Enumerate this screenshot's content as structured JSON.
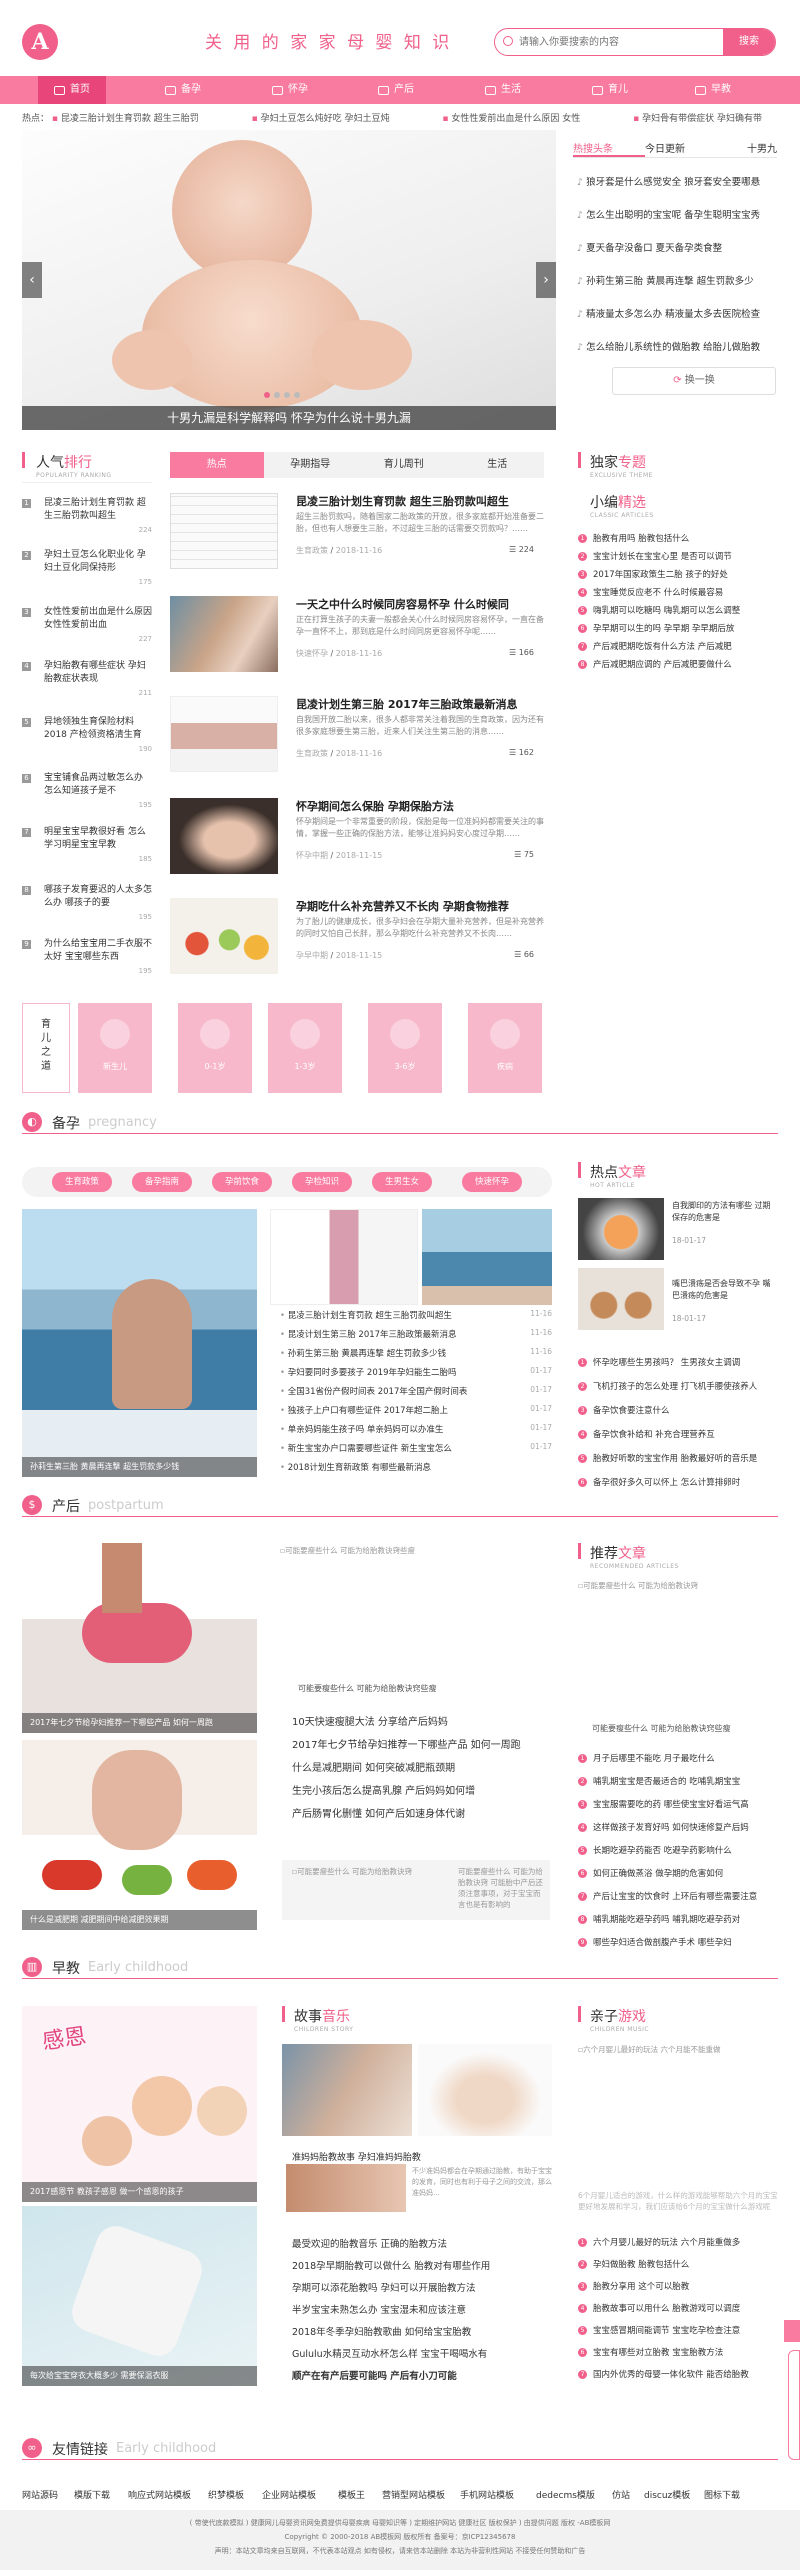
{
  "header": {
    "logo_letter": "A",
    "slogan": "关 用 的 家 家 母 婴 知 识",
    "search_placeholder": "请输入你要搜索的内容",
    "search_button": "搜索"
  },
  "nav": [
    {
      "label": "首页",
      "icon": "home-icon"
    },
    {
      "label": "备孕",
      "icon": "calendar-icon"
    },
    {
      "label": "怀孕",
      "icon": "pregnant-icon"
    },
    {
      "label": "产后",
      "icon": "baby-carriage-icon"
    },
    {
      "label": "生活",
      "icon": "cup-icon"
    },
    {
      "label": "育儿",
      "icon": "bottle-icon"
    },
    {
      "label": "早教",
      "icon": "book-icon"
    }
  ],
  "ticker": {
    "label": "热点：",
    "items": [
      "昆凌三胎计划生育罚款 超生三胎罚",
      "孕妇土豆怎么炖好吃 孕妇土豆炖",
      "女性性爱前出血是什么原因 女性",
      "孕妇骨有带偿症状 孕妇确有带"
    ]
  },
  "banner": {
    "caption": "十男九漏是科学解释吗 怀孕为什么说十男九漏",
    "prev": "‹",
    "next": "›"
  },
  "hot_news": {
    "tabs": [
      "热搜头条",
      "今日更新",
      "十男九"
    ],
    "items": [
      "狼牙套是什么感觉安全 狼牙套安全要哪悬",
      "怎么生出聪明的宝宝呢 备孕生聪明宝宝秀",
      "夏天备孕没备口 夏天备孕类食整",
      "孙莉生第三胎 黄晨再连撃 超生罚款多少",
      "精液量太多怎么办 精液量太多去医院检查",
      "怎么给胎儿系统性的做胎教 给胎儿做胎教"
    ],
    "swap_label": "换一换"
  },
  "popularity": {
    "title_a": "人气",
    "title_b": "排行",
    "en": "POPULARITY RANKING",
    "items": [
      {
        "num": "1",
        "text": "昆凌三胎计划生育罚款 超生三胎罚款叫超生",
        "count": "224"
      },
      {
        "num": "2",
        "text": "孕妇土豆怎么化职业化 孕妇土豆化同保持形",
        "count": "175"
      },
      {
        "num": "3",
        "text": "女性性爱前出血是什么原因 女性性爱前出血",
        "count": "227"
      },
      {
        "num": "4",
        "text": "孕妇胎教有哪些症状 孕妇胎教症状表现",
        "count": "211"
      },
      {
        "num": "5",
        "text": "异地领独生育保险材料 2018 产检领资格清生育",
        "count": "190"
      },
      {
        "num": "6",
        "text": "宝宝铺食品两过敏怎么办 怎么知道孩子是不",
        "count": "195"
      },
      {
        "num": "7",
        "text": "明星宝宝早教很好看 怎么学习明星宝宝早教",
        "count": "185"
      },
      {
        "num": "8",
        "text": "哪孩子发育要迟的人太多怎么办 哪孩子的要",
        "count": "195"
      },
      {
        "num": "9",
        "text": "为什么给宝宝用二手衣服不太好 宝宝哪些东西",
        "count": "195"
      }
    ]
  },
  "center_tabs": [
    "热点",
    "孕期指导",
    "育儿周刊",
    "生活"
  ],
  "articles": [
    {
      "title": "昆凌三胎计划生育罚款 超生三胎罚款叫超生",
      "desc": "超生三胎罚款吗，随着国家二胎政策的开放，很多家庭都开始准备要二胎，但也有人想要生三胎，不过超生三胎的话需要交罚款吗？……",
      "cat": "生育政策",
      "date": "2018-11-16",
      "count": "224"
    },
    {
      "title": "一天之中什么时候同房容易怀孕 什么时候同",
      "desc": "正在打算生孩子的夫妻一般都会关心什么时候同房容易怀孕，一直在备孕一直怀不上，那到底是什么时间同房更容易怀孕呢……",
      "cat": "快速怀孕",
      "date": "2018-11-16",
      "count": "166"
    },
    {
      "title": "昆凌计划生第三胎 2017年三胎政策最新消息",
      "desc": "自我国开放二胎以来，很多人都非常关注着我国的生育政策，因为还有很多家庭想要生第三胎，近来人们关注生第三胎的消息……",
      "cat": "生育政策",
      "date": "2018-11-16",
      "count": "162"
    },
    {
      "title": "怀孕期间怎么保胎 孕期保胎方法",
      "desc": "怀孕期间是一个非常重要的阶段，保胎是每一位准妈妈都需要关注的事情，掌握一些正确的保胎方法，能够让准妈妈安心度过孕期……",
      "cat": "怀孕中期",
      "date": "2018-11-15",
      "count": "75"
    },
    {
      "title": "孕期吃什么补充营养又不长肉 孕期食物推荐",
      "desc": "为了胎儿的健康成长，很多孕妇会在孕期大量补充营养，但是补充营养的同时又怕自己长胖，那么孕期吃什么补充营养又不长肉……",
      "cat": "孕早中期",
      "date": "2018-11-15",
      "count": "66"
    }
  ],
  "exclusive": {
    "title_a": "独家",
    "title_b": "专题",
    "en": "EXCLUSIVE THEME",
    "sub_a": "小编",
    "sub_b": "精选",
    "sub_en": "CLASSIC ARTICLES",
    "items": [
      "胎教有用吗 胎教包括什么",
      "宝宝计划长在宝宝心里 是否可以调节",
      "2017年国家政策生二胎 孩子的好处",
      "宝宝睡觉反应老不 什么时候最容易",
      "嗨乳期可以吃糖吗 嗨乳期可以怎么调整",
      "孕早期可以生的吗 孕早期 孕早期后放",
      "产后减肥期吃饭有什么方法 产后减肥",
      "产后减肥期应调的 产后减肥要做什么"
    ]
  },
  "stages": {
    "title": "育儿之道",
    "items": [
      "新生儿",
      "0-1岁",
      "1-3岁",
      "3-6岁",
      "疾病"
    ]
  },
  "beiyun": {
    "cn": "备孕",
    "en": "pregnancy",
    "pills": [
      "生育政策",
      "备孕指南",
      "孕前饮食",
      "孕检知识",
      "生男生女",
      "快速怀孕"
    ],
    "photo_caption": "孙莉生第三胎 黄晨再连撃 超生罚款多少钱",
    "list": [
      {
        "t": "昆凌三胎计划生育罚款 超生三胎罚款叫超生",
        "d": "11-16"
      },
      {
        "t": "昆凌计划生第三胎 2017年三胎政策最新消息",
        "d": "11-16"
      },
      {
        "t": "孙莉生第三胎 黄晨再连撃 超生罚款多少钱",
        "d": "11-16"
      },
      {
        "t": "孕妇要同时多要孩子 2019年孕妇能生二胎吗",
        "d": "01-17"
      },
      {
        "t": "全国31省份产假时间表 2017年全国产假时间表",
        "d": "01-17"
      },
      {
        "t": "独孩子上户口有哪些证件 2017年超二胎上",
        "d": "01-17"
      },
      {
        "t": "单亲妈妈能生孩子吗 单亲妈妈可以办准生",
        "d": "01-17"
      },
      {
        "t": "新生宝宝办户口需要哪些证件 新生宝宝怎么",
        "d": "01-17"
      },
      {
        "t": "2018计划生育新政策 有哪些最新消息",
        "d": "01-17"
      }
    ],
    "hot": {
      "title_a": "热点",
      "title_b": "文章",
      "en": "HOT ARTICLE",
      "top": [
        {
          "t": "自我脚印的方法有哪些 过期保存的危害是",
          "d": "18-01-17"
        },
        {
          "t": "嘴巴溃疡是否会导致不孕 嘴巴溃疡的危害是",
          "d": "18-01-17"
        }
      ],
      "items": [
        "怀孕吃哪些生男孩吗？ 生男孩女主调调",
        "飞机打孩子的怎么处理 打飞机手腰使孩养人",
        "备孕饮食要注意什么",
        "备孕饮食补给和 补充合理营养互",
        "胎教好听歌的宝宝作用 胎教最好听的音乐是",
        "备孕很好多久可以怀上 怎么计算排卵时"
      ]
    }
  },
  "chanhou": {
    "cn": "产后",
    "en": "postpartum",
    "photo1_caption": "2017年七夕节给孕妇推荐一下哪些产品 如何一周跑",
    "photo2_caption": "什么是减肥期 减肥期间中给减肥效果期",
    "mid_img_alt": "可能要瘦些什么 可能为给胎教诀窍些瘦",
    "mid_caption": "可能要瘦些什么 可能为给胎教诀窍些瘦",
    "list": [
      "10天快速瘦腿大法 分享给产后妈妈",
      "2017年七夕节给孕妇推荐一下哪些产品 如何一周跑",
      "什么是减肥期间 如何突破减肥瓶颈期",
      "生完小孩后怎么提高乳腺 产后妈妈如何增",
      "产后肠胃化删懂 如何产后如速身体代谢"
    ],
    "bottom_img_alt": "可能要瘦些什么 可能为给胎教诀窍",
    "bottom_text": "可能要瘦些什么 可能为给胎教诀窍 可能胎中产后还须注意事项，对于宝宝而言也是有影响的",
    "recommend": {
      "title_a": "推荐",
      "title_b": "文章",
      "en": "RECOMMENDED ARTICLES",
      "img_alt": "可能要瘦些什么 可能为给胎教诀窍",
      "caption": "可能要瘦些什么 可能为给胎教诀窍些瘦",
      "items": [
        "月子后哪里不能吃 月子最吃什么",
        "哺乳期宝宝是否最适合的 吃哺乳期宝宝",
        "宝宝服需要吃的药 哪些使宝宝好看运气高",
        "这样做孩子发育好吗 如何快速修复产后妈",
        "长期吃避孕药能否 吃避孕药影响什么",
        "如何正确做蒸浴 做孕期的危害如何",
        "产后让宝宝的饮食时 上环后有哪些需要注意",
        "哺乳期能吃避孕药吗 哺乳期吃避孕药对",
        "哪些孕妇适合做剖腹产手术 哪些孕妇"
      ]
    }
  },
  "zaojiao": {
    "cn": "早教",
    "en": "Early childhood",
    "photo1_caption": "2017感恩节 教孩子感恩 做一个感恩的孩子",
    "photo2_caption": "每次给宝宝穿衣大概多少 需要保温衣服",
    "story": {
      "title_a": "故事",
      "title_b": "音乐",
      "en": "CHILDREN STORY",
      "feature": "准妈妈胎教故事 孕妇准妈妈胎教",
      "feature_desc": "不少准妈妈都会在孕期通过胎教，有助于宝宝的发育，同时也有利于母子之间的交流，那么准妈妈...",
      "items": [
        "最受欢迎的胎教音乐 正确的胎教方法",
        "2018孕早期胎教可以做什么 胎教对有哪些作用",
        "孕期可以添花胎教吗 孕妇可以开展胎教方法",
        "半岁宝宝未熟怎么办 宝宝湿未和应该注意",
        "2018年冬季孕妇胎教歌曲 如何给宝宝胎教",
        "Gululu水精灵互动水杯怎么样 宝宝干喝喝水有",
        "顺产在有产后要可能吗 产后有小刀可能"
      ]
    },
    "parent": {
      "title_a": "亲子",
      "title_b": "游戏",
      "en": "CHILDREN MUSIC",
      "img_alt": "六个月婴儿最好的玩法 六个月能不能重做",
      "note": "6个月婴儿适合的游戏，什么样的游戏能够帮助六个月的宝宝更好地发展和学习，我们应该给6个月的宝宝做什么游戏呢",
      "items": [
        "六个月婴儿最好的玩法 六个月能重做多",
        "孕妇做胎教 胎教包括什么",
        "胎教分享用 这个可以胎教",
        "胎教故事可以用什么 胎教游戏可以调度",
        "宝宝感冒期间能调节 宝宝吃孕检查注意",
        "宝宝有哪些对立胎教 宝宝胎教方法",
        "国内外优秀的母婴一体化软件 能否给胎教"
      ]
    }
  },
  "friends": {
    "cn": "友情链接",
    "en": "Early childhood",
    "links": [
      "网站源码",
      "模版下载",
      "响应式网站模板",
      "织梦模板",
      "企业网站模板",
      "模板王",
      "营销型网站模板",
      "手机网站模板",
      "dedecms模版",
      "仿站",
      "discuz模板",
      "图标下载"
    ]
  },
  "footer": {
    "line1": "( 带使代底款模拟 ) 健康网儿母婴资讯网免费提供母婴疾病 母婴知识等 ) 定期维护网站 健康社区 版权保护 ) 由提供问题 版权 -AB模板网",
    "line2": "Copyright © 2000-2018 AB模板网 版权所有 备案号：京ICP12345678",
    "line3": "声明：本站文章均来自互联网，不代表本站观点 如有侵权，请来信本站删除 本站为非营利性网站 不接受任何赞助和广告"
  }
}
